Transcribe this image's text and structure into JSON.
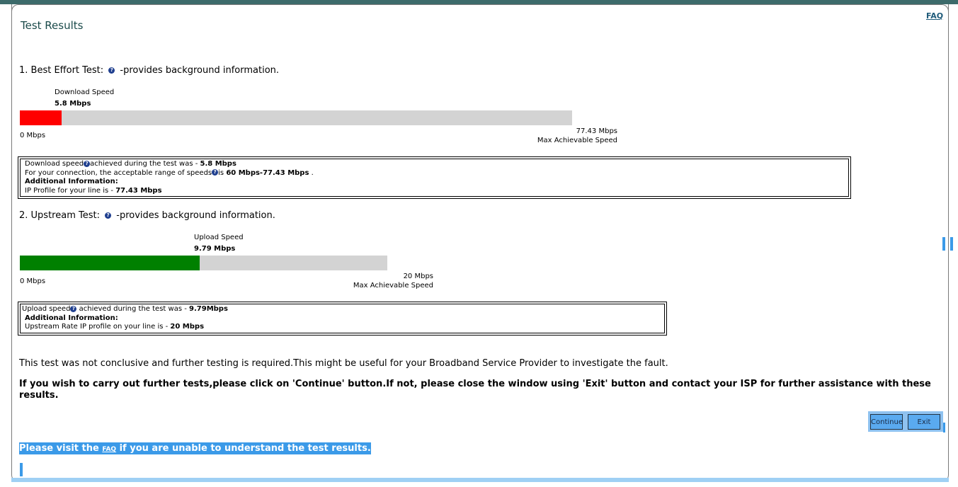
{
  "header": {
    "title": "Test Results",
    "faq_link": "FAQ"
  },
  "best_effort": {
    "heading": "1. Best Effort Test:",
    "heading_suffix": "-provides background information.",
    "bar_label": "Download Speed",
    "speed": "5.8 Mbps",
    "min_label": "0 Mbps",
    "max_value": "77.43 Mbps",
    "max_label": "Max Achievable Speed",
    "fill_fraction": 0.075,
    "fill_color": "#ff0000",
    "info": {
      "line1_prefix": "Download speed",
      "line1_mid": "achieved during the test was - ",
      "line1_value": "5.8 Mbps",
      "line2_prefix": "For your connection, the acceptable range of speeds",
      "line2_mid": "is ",
      "line2_value": "60 Mbps-77.43 Mbps",
      "line2_suffix": " .",
      "line3": "Additional Information:",
      "line4_prefix": "IP Profile for your line is - ",
      "line4_value": "77.43 Mbps"
    }
  },
  "upstream": {
    "heading": "2. Upstream Test:",
    "heading_suffix": "-provides background information.",
    "bar_label": "Upload Speed",
    "speed": "9.79 Mbps",
    "min_label": "0 Mbps",
    "max_value": "20 Mbps",
    "max_label": "Max Achievable Speed",
    "fill_fraction": 0.4895,
    "fill_color": "#008000",
    "info": {
      "line1_prefix": "Upload speed",
      "line1_mid": " achieved during the test was - ",
      "line1_value": "9.79Mbps",
      "line2": "Additional Information:",
      "line3_prefix": "Upstream Rate IP profile on your line is - ",
      "line3_value": "20 Mbps"
    }
  },
  "messages": {
    "inconclusive": "This test was not conclusive and further testing is required.This might be useful for your Broadband Service Provider to investigate the fault.",
    "instruction": "If you wish to carry out further tests,please click on 'Continue' button.If not, please close the window using 'Exit' button and contact your ISP for further assistance with these results.",
    "visit_prefix": "Please visit the ",
    "visit_faq": "FAQ",
    "visit_suffix": " if you are unable to understand the test results."
  },
  "buttons": {
    "continue": "Continue",
    "exit": "Exit"
  },
  "icons": {
    "help": "help-icon"
  }
}
